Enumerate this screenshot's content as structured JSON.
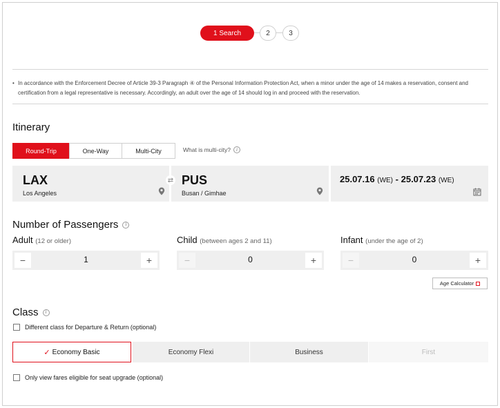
{
  "steps": [
    {
      "label": "1  Search",
      "active": true
    },
    {
      "label": "2",
      "active": false
    },
    {
      "label": "3",
      "active": false
    }
  ],
  "notice": "In accordance with the Enforcement Decree of Article 39-3 Paragraph ④ of the Personal Information Protection Act, when a minor under the age of 14 makes a reservation, consent and certification from a legal representative is necessary. Accordingly, an adult over the age of 14 should log in and proceed with the reservation.",
  "itinerary": {
    "title": "Itinerary",
    "tabs": [
      "Round-Trip",
      "One-Way",
      "Multi-City"
    ],
    "multi_city_help": "What is multi-city?",
    "origin": {
      "code": "LAX",
      "city": "Los Angeles"
    },
    "destination": {
      "code": "PUS",
      "city": "Busan / Gimhae"
    },
    "depart_date": "25.07.16",
    "depart_dow": "(WE)",
    "date_separator": "-",
    "return_date": "25.07.23",
    "return_dow": "(WE)"
  },
  "passengers": {
    "title": "Number of Passengers",
    "adult": {
      "label": "Adult",
      "sub": "(12 or older)",
      "count": "1"
    },
    "child": {
      "label": "Child",
      "sub": "(between ages 2 and 11)",
      "count": "0"
    },
    "infant": {
      "label": "Infant",
      "sub": "(under the age of 2)",
      "count": "0"
    },
    "age_calculator": "Age Calculator"
  },
  "class_section": {
    "title": "Class",
    "different_class_label": "Different class for Departure & Return (optional)",
    "options": [
      "Economy Basic",
      "Economy Flexi",
      "Business",
      "First"
    ],
    "selected": "Economy Basic",
    "upgrade_label": "Only view fares eligible for seat upgrade (optional)"
  },
  "colors": {
    "accent": "#e0101b",
    "panel": "#efefef"
  }
}
